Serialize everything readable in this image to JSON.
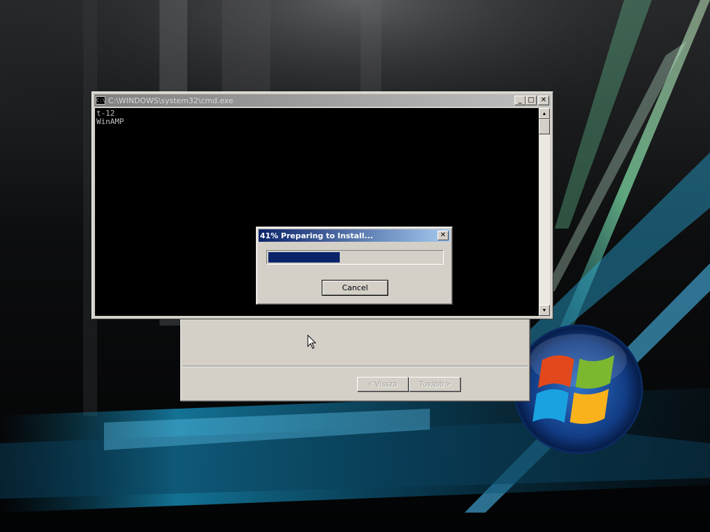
{
  "colors": {
    "desktop_bg": "#050608",
    "dialog_title_start": "#0a246a",
    "dialog_title_end": "#a6caf0",
    "progress_fill": "#0a246a",
    "console_bg": "#000000",
    "console_text": "#c0c0c0"
  },
  "cmd_window": {
    "icon": "console-icon",
    "icon_glyph": "C:\\",
    "title": "C:\\WINDOWS\\system32\\cmd.exe",
    "minimize_glyph": "_",
    "maximize_glyph": "□",
    "close_glyph": "✕",
    "console_lines": [
      "t-12",
      "WinAMP"
    ]
  },
  "progress_dialog": {
    "title": "41% Preparing to Install...",
    "close_glyph": "✕",
    "progress_percent": 41,
    "cancel_label": "Cancel"
  },
  "installer_window": {
    "back_label": "< Vissza",
    "next_label": "Tovább >"
  },
  "taskbar_logo": "windows-logo"
}
